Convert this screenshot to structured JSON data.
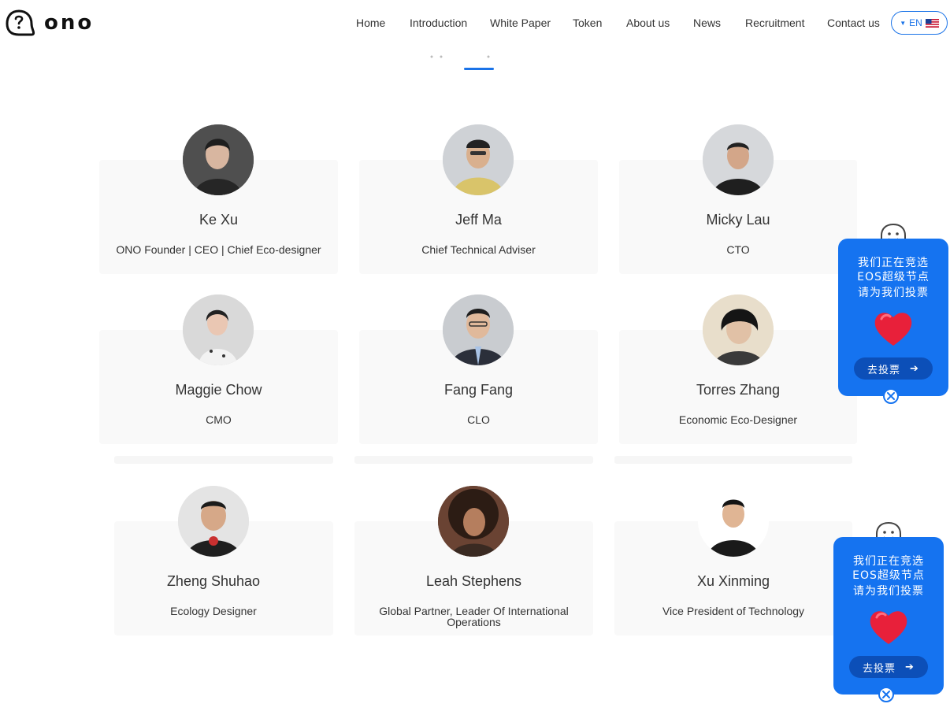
{
  "brand": {
    "name": "ono",
    "icon": "ono-mascot-logo-icon"
  },
  "nav": {
    "items": [
      {
        "label": "Home"
      },
      {
        "label": "Introduction"
      },
      {
        "label": "White Paper"
      },
      {
        "label": "Token"
      },
      {
        "label": "About us"
      },
      {
        "label": "News"
      },
      {
        "label": "Recruitment"
      },
      {
        "label": "Contact us"
      }
    ],
    "language": {
      "label": "EN",
      "caret_icon": "caret-down-icon",
      "flag_icon": "us-flag-icon"
    }
  },
  "team": {
    "members": [
      {
        "name": "Ke Xu",
        "role": "ONO Founder | CEO | Chief Eco-designer"
      },
      {
        "name": "Jeff Ma",
        "role": "Chief Technical Adviser"
      },
      {
        "name": "Micky Lau",
        "role": "CTO"
      },
      {
        "name": "Maggie Chow",
        "role": "CMO"
      },
      {
        "name": "Fang Fang",
        "role": "CLO"
      },
      {
        "name": "Torres Zhang",
        "role": "Economic Eco-Designer"
      },
      {
        "name": "Zheng Shuhao",
        "role": "Ecology Designer"
      },
      {
        "name": "Leah Stephens",
        "role": "Global Partner, Leader Of International Operations"
      },
      {
        "name": "Xu Xinming",
        "role": "Vice President of Technology"
      }
    ]
  },
  "vote_widget": {
    "lines": [
      "我们正在竞选",
      "EOS超级节点",
      "请为我们投票"
    ],
    "button_label": "去投票",
    "icons": [
      "mascot-icon",
      "heart-icon",
      "arrow-right-icon",
      "close-icon"
    ],
    "colors": {
      "panel": "#1573f0",
      "button": "#0c4fb8",
      "heart": "#e8203a"
    }
  },
  "colors": {
    "accent": "#1a73e8",
    "card": "#f9f9f9"
  }
}
